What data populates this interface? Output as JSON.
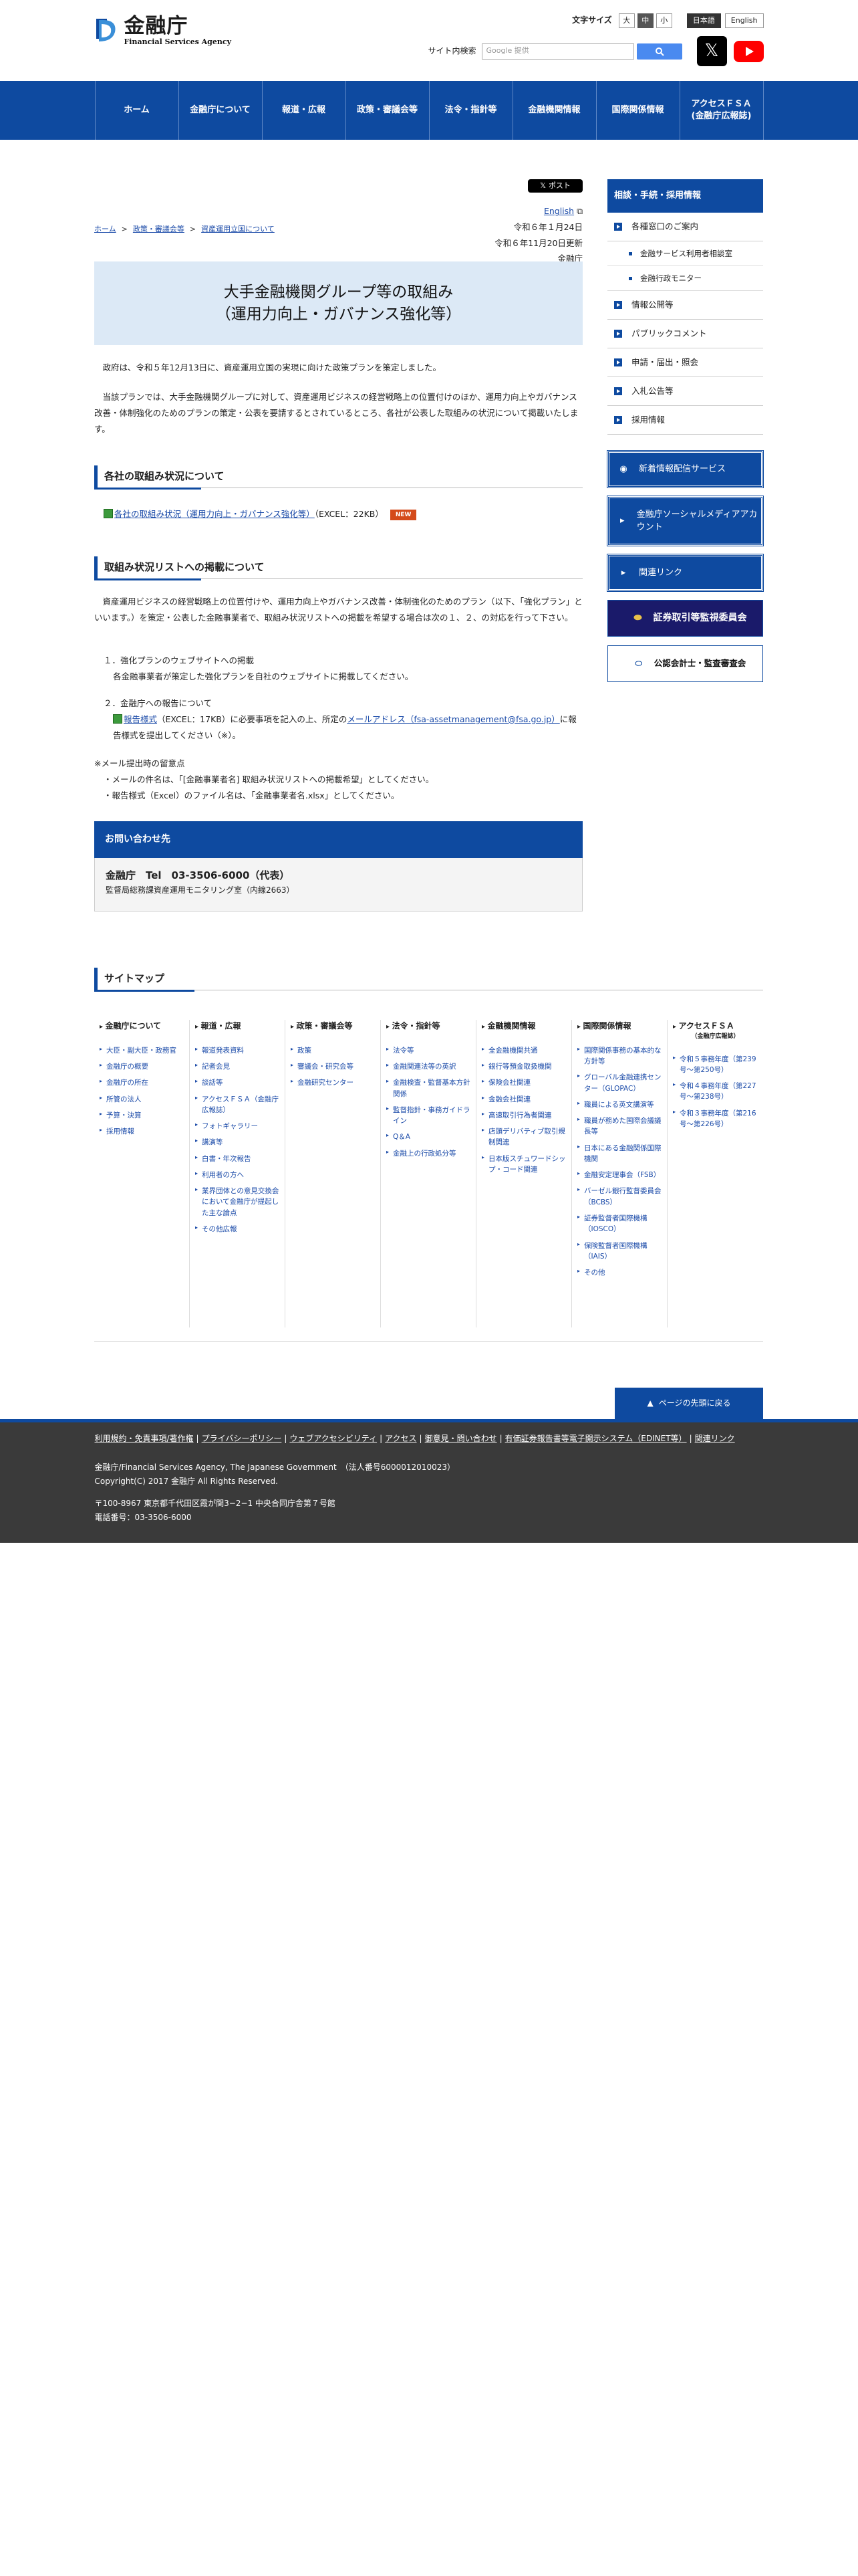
{
  "header": {
    "logo_ja": "金融庁",
    "logo_en": "Financial Services Agency",
    "font_size_label": "文字サイズ",
    "font_sizes": [
      "大",
      "中",
      "小"
    ],
    "lang_ja": "日本語",
    "lang_en": "English",
    "search_label": "サイト内検索",
    "search_placeholder": "Google 提供"
  },
  "nav": [
    "ホーム",
    "金融庁について",
    "報道・広報",
    "政策・審議会等",
    "法令・指針等",
    "金融機関情報",
    "国際関係情報",
    "アクセスＦＳＡ\n(金融庁広報誌)"
  ],
  "breadcrumb": [
    "ホーム",
    "政策・審議会等",
    "資産運用立国について"
  ],
  "tweet_label": "ポスト",
  "meta": {
    "english": "English",
    "published": "令和６年１月24日",
    "updated": "令和６年11月20日更新",
    "agency": "金融庁"
  },
  "title_line1": "大手金融機関グループ等の取組み",
  "title_line2": "（運用力向上・ガバナンス強化等）",
  "intro1": "政府は、令和５年12月13日に、資産運用立国の実現に向けた政策プランを策定しました。",
  "intro2": "当該プランでは、大手金融機関グループに対して、資産運用ビジネスの経営戦略上の位置付けのほか、運用力向上やガバナンス改善・体制強化のためのプランの策定・公表を要請するとされているところ、各社が公表した取組みの状況について掲載いたします。",
  "section1": {
    "heading": "各社の取組み状況について",
    "link": "各社の取組み状況（運用力向上・ガバナンス強化等）",
    "file_info": "（EXCEL：22KB）",
    "badge": "NEW"
  },
  "section2": {
    "heading": "取組み状況リストへの掲載について",
    "body": "資産運用ビジネスの経営戦略上の位置付けや、運用力向上やガバナンス改善・体制強化のためのプラン（以下、「強化プラン」といいます。）を策定・公表した金融事業者で、取組み状況リストへの掲載を希望する場合は次の１、２、の対応を行って下さい。",
    "item1_title": "１．強化プランのウェブサイトへの掲載",
    "item1_body": "各金融事業者が策定した強化プランを自社のウェブサイトに掲載してください。",
    "item2_title": "２．金融庁への報告について",
    "item2_link1": "報告様式",
    "item2_text1": "（EXCEL：17KB）に必要事項を記入の上、所定の",
    "item2_link2": "メールアドレス（fsa-assetmanagement@fsa.go.jp）",
    "item2_text2": "に報告様式を提出してください（※）。",
    "note_title": "※メール提出時の留意点",
    "note1": "・メールの件名は、「[金融事業者名] 取組み状況リストへの掲載希望」としてください。",
    "note2": "・報告様式（Excel）のファイル名は、「金融事業者名.xlsx」としてください。"
  },
  "contact": {
    "heading": "お問い合わせ先",
    "tel": "金融庁　Tel　03-3506-6000（代表）",
    "dept": "監督局総務課資産運用モニタリング室（内線2663）"
  },
  "sidebar": {
    "heading": "相談・手続・採用情報",
    "items": [
      {
        "label": "各種窓口のご案内",
        "type": "main"
      },
      {
        "label": "金融サービス利用者相談室",
        "type": "sub"
      },
      {
        "label": "金融行政モニター",
        "type": "sub"
      },
      {
        "label": "情報公開等",
        "type": "main"
      },
      {
        "label": "パブリックコメント",
        "type": "main"
      },
      {
        "label": "申請・届出・照会",
        "type": "main"
      },
      {
        "label": "入札公告等",
        "type": "main"
      },
      {
        "label": "採用情報",
        "type": "main"
      }
    ],
    "banner1": "新着情報配信サービス",
    "banner2": "金融庁ソーシャルメディアアカウント",
    "banner3": "関連リンク",
    "banner4": "証券取引等監視委員会",
    "banner5": "公認会計士・監査審査会"
  },
  "sitemap": {
    "heading": "サイトマップ",
    "columns": [
      {
        "title": "金融庁について",
        "sub": "",
        "items": [
          "大臣・副大臣・政務官",
          "金融庁の概要",
          "金融庁の所在",
          "所管の法人",
          "予算・決算",
          "採用情報"
        ]
      },
      {
        "title": "報道・広報",
        "sub": "",
        "items": [
          "報道発表資料",
          "記者会見",
          "談話等",
          "アクセスＦＳＡ（金融庁広報誌）",
          "フォトギャラリー",
          "講演等",
          "白書・年次報告",
          "利用者の方へ",
          "業界団体との意見交換会において金融庁が提起した主な論点",
          "その他広報"
        ]
      },
      {
        "title": "政策・審議会等",
        "sub": "",
        "items": [
          "政策",
          "審議会・研究会等",
          "金融研究センター"
        ]
      },
      {
        "title": "法令・指針等",
        "sub": "",
        "items": [
          "法令等",
          "金融関連法等の英訳",
          "金融検査・監督基本方針関係",
          "監督指針・事務ガイドライン",
          "Q＆A",
          "金融上の行政処分等"
        ]
      },
      {
        "title": "金融機関情報",
        "sub": "",
        "items": [
          "全金融機関共通",
          "銀行等預金取扱機関",
          "保険会社関連",
          "金融会社関連",
          "高速取引行為者関連",
          "店頭デリバティブ取引規制関連",
          "日本版スチュワードシップ・コード関連"
        ]
      },
      {
        "title": "国際関係情報",
        "sub": "",
        "items": [
          "国際関係事務の基本的な方針等",
          "グローバル金融連携センター（GLOPAC）",
          "職員による英文講演等",
          "職員が務めた国際会議議長等",
          "日本にある金融関係国際機関",
          "金融安定理事会（FSB）",
          "バーゼル銀行監督委員会（BCBS）",
          "証券監督者国際機構（IOSCO）",
          "保険監督者国際機構（IAIS）",
          "その他"
        ]
      },
      {
        "title": "アクセスＦＳＡ",
        "sub": "（金融庁広報誌）",
        "items": [
          "令和５事務年度（第239号〜第250号）",
          "令和４事務年度（第227号〜第238号）",
          "令和３事務年度（第216号〜第226号）"
        ]
      }
    ]
  },
  "pagetop": "ページの先頭に戻る",
  "footer": {
    "links": [
      "利用規約・免責事項/著作権",
      "プライバシーポリシー",
      "ウェブアクセシビリティ",
      "アクセス",
      "御意見・問い合わせ",
      "有価証券報告書等電子開示システム（EDINET等）",
      "関連リンク"
    ],
    "org": "金融庁/Financial Services Agency, The Japanese Government　（法人番号6000012010023）",
    "copyright": "Copyright(C) 2017 金融庁 All Rights Reserved.",
    "address": "〒100-8967 東京都千代田区霞が関3−2−1 中央合同庁舎第７号館",
    "phone": "電話番号：03-3506-6000"
  }
}
